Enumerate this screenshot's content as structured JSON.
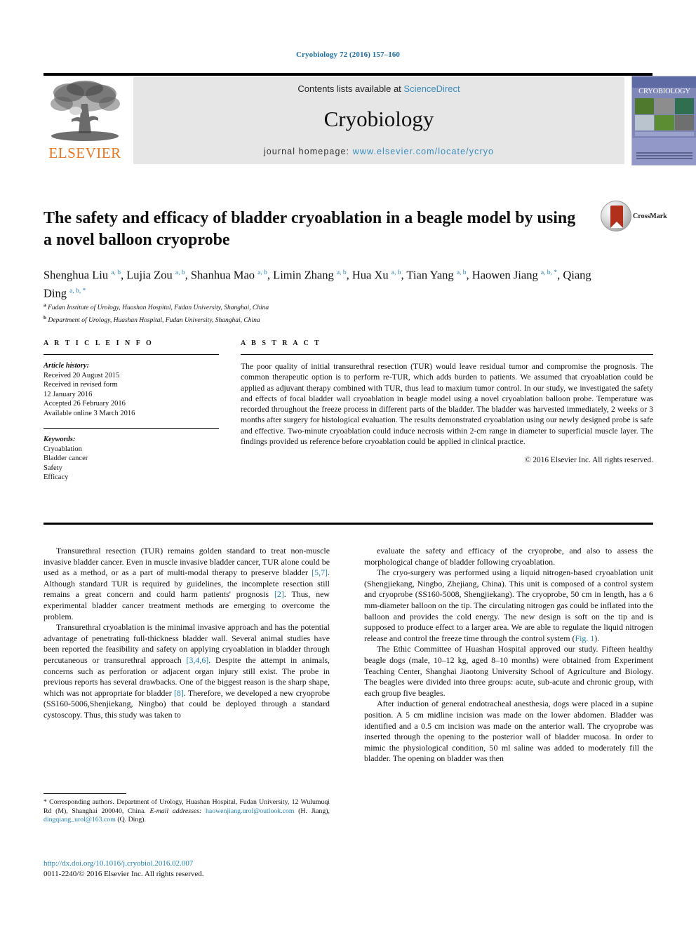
{
  "running_head": "Cryobiology 72 (2016) 157–160",
  "masthead": {
    "contents_prefix": "Contents lists available at ",
    "sciencedirect": "ScienceDirect",
    "journal_name": "Cryobiology",
    "homepage_prefix": "journal homepage: ",
    "homepage_url": "www.elsevier.com/locate/ycryo",
    "publisher_logo_text": "ELSEVIER",
    "cover_title": "CRYOBIOLOGY",
    "accent_link_color": "#3a8dbd",
    "publisher_color": "#e87722"
  },
  "article": {
    "title": "The safety and efficacy of bladder cryoablation in a beagle model by using a novel balloon cryoprobe",
    "crossmark_label": "CrossMark",
    "authors_html": "Shenghua Liu <sup>a, b</sup>, Lujia Zou <sup>a, b</sup>, Shanhua Mao <sup>a, b</sup>, Limin Zhang <sup>a, b</sup>, Hua Xu <sup>a, b</sup>, Tian Yang <sup>a, b</sup>, Haowen Jiang <sup>a, b, *</sup>, Qiang Ding <sup>a, b, *</sup>",
    "affiliations": [
      {
        "marker": "a",
        "text": "Fudan Institute of Urology, Huashan Hospital, Fudan University, Shanghai, China"
      },
      {
        "marker": "b",
        "text": "Department of Urology, Huashan Hospital, Fudan University, Shanghai, China"
      }
    ]
  },
  "article_info": {
    "heading": "A R T I C L E   I N F O",
    "history_label": "Article history:",
    "history": [
      "Received 20 August 2015",
      "Received in revised form",
      "12 January 2016",
      "Accepted 26 February 2016",
      "Available online 3 March 2016"
    ],
    "keywords_label": "Keywords:",
    "keywords": [
      "Cryoablation",
      "Bladder cancer",
      "Safety",
      "Efficacy"
    ]
  },
  "abstract": {
    "heading": "A B S T R A C T",
    "text": "The poor quality of initial transurethral resection (TUR) would leave residual tumor and compromise the prognosis. The common therapeutic option is to perform re-TUR, which adds burden to patients. We assumed that cryoablation could be applied as adjuvant therapy combined with TUR, thus lead to maxium tumor control. In our study, we investigated the safety and effects of focal bladder wall cryoablation in beagle model using a novel cryoablation balloon probe. Temperature was recorded throughout the freeze process in different parts of the bladder. The bladder was harvested immediately, 2 weeks or 3 months after surgery for histological evaluation. The results demonstrated cryoablation using our newly designed probe is safe and effective. Two-minute cryoablation could induce necrosis within 2-cm range in diameter to superficial muscle layer. The findings provided us reference before cryoablation could be applied in clinical practice.",
    "copyright": "© 2016 Elsevier Inc. All rights reserved."
  },
  "body": {
    "left_paragraphs": [
      "Transurethral resection (TUR) remains golden standard to treat non-muscle invasive bladder cancer. Even in muscle invasive bladder cancer, TUR alone could be used as a method, or as a part of multi-modal therapy to preserve bladder [5,7]. Although standard TUR is required by guidelines, the incomplete resection still remains a great concern and could harm patients' prognosis [2]. Thus, new experimental bladder cancer treatment methods are emerging to overcome the problem.",
      "Transurethral cryoablation is the minimal invasive approach and has the potential advantage of penetrating full-thickness bladder wall. Several animal studies have been reported the feasibility and safety on applying cryoablation in bladder through percutaneous or transurethral approach [3,4,6]. Despite the attempt in animals, concerns such as perforation or adjacent organ injury still exist. The probe in previous reports has several drawbacks. One of the biggest reason is the sharp shape, which was not appropriate for bladder [8]. Therefore, we developed a new cryoprobe (SS160-5006,Shenjiekang, Ningbo) that could be deployed through a standard cystoscopy. Thus, this study was taken to"
    ],
    "right_paragraphs": [
      "evaluate the safety and efficacy of the cryoprobe, and also to assess the morphological change of bladder following cryoablation.",
      "The cryo-surgery was performed using a liquid nitrogen-based cryoablation unit (Shengjiekang, Ningbo, Zhejiang, China). This unit is composed of a control system and cryoprobe (SS160-5008, Shengjiekang). The cryoprobe, 50 cm in length, has a 6 mm-diameter balloon on the tip. The circulating nitrogen gas could be inflated into the balloon and provides the cold energy. The new design is soft on the tip and is supposed to produce effect to a larger area. We are able to regulate the liquid nitrogen release and control the freeze time through the control system (Fig. 1).",
      "The Ethic Committee of Huashan Hospital approved our study. Fifteen healthy beagle dogs (male, 10–12 kg, aged 8–10 months) were obtained from Experiment Teaching Center, Shanghai Jiaotong University School of Agriculture and Biology. The beagles were divided into three groups: acute, sub-acute and chronic group, with each group five beagles.",
      "After induction of general endotracheal anesthesia, dogs were placed in a supine position. A 5 cm midline incision was made on the lower abdomen. Bladder was identified and a 0.5 cm incision was made on the anterior wall. The cryoprobe was inserted through the opening to the posterior wall of bladder mucosa. In order to mimic the physiological condition, 50 ml saline was added to moderately fill the bladder. The opening on bladder was then"
    ],
    "reference_color": "#1f7fb0"
  },
  "footnote": {
    "corresponding": "* Corresponding authors. Department of Urology, Huashan Hospital, Fudan University, 12 Wulumuqi Rd (M), Shanghai 200040, China.",
    "email_label": "E-mail addresses:",
    "email1": "haowenjiang.urol@outlook.com",
    "email1_owner": "(H. Jiang),",
    "email2": "dingqiang_urol@163.com",
    "email2_owner": "(Q. Ding)."
  },
  "doi": {
    "url": "http://dx.doi.org/10.1016/j.cryobiol.2016.02.007",
    "issn_line": "0011-2240/© 2016 Elsevier Inc. All rights reserved."
  }
}
